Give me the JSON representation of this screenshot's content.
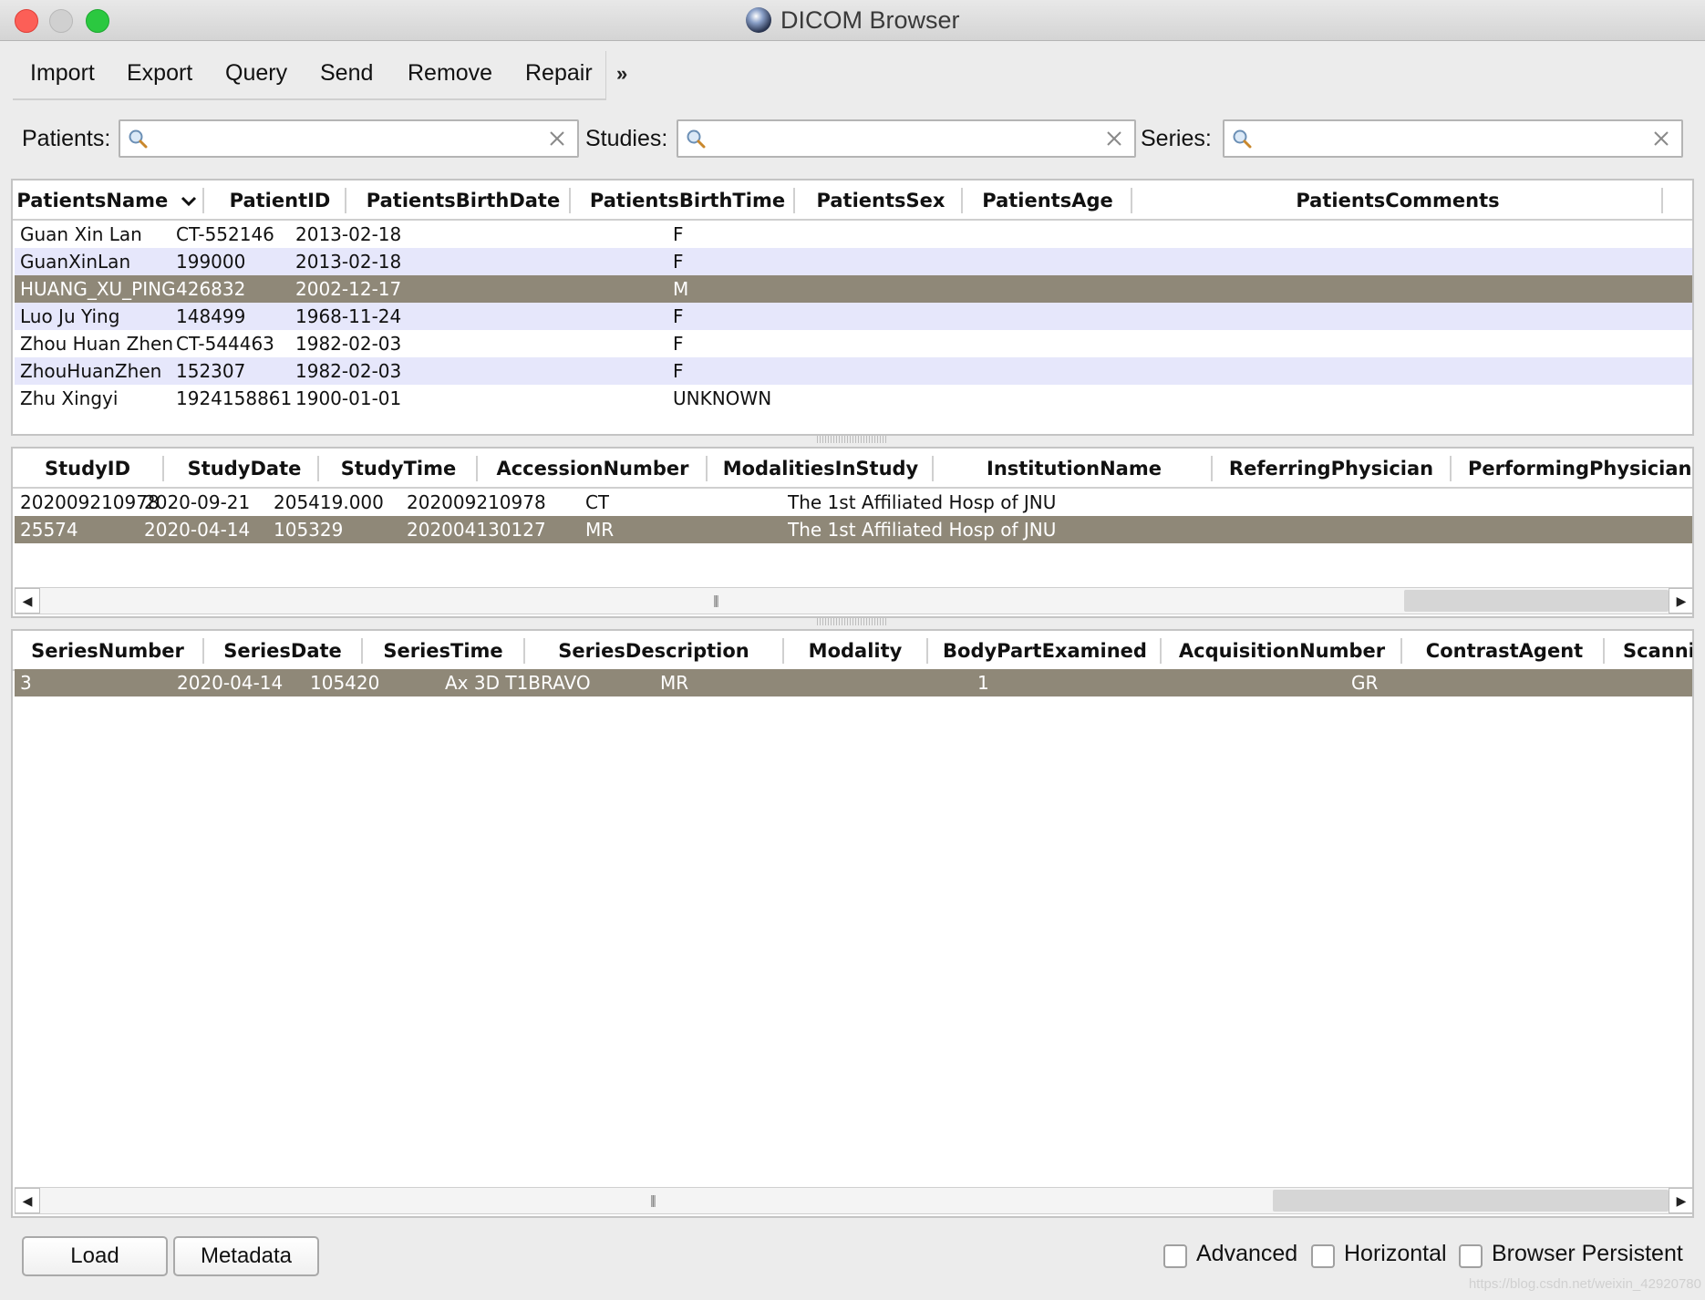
{
  "window": {
    "title": "DICOM Browser"
  },
  "toolbar": {
    "import": "Import",
    "export": "Export",
    "query": "Query",
    "send": "Send",
    "remove": "Remove",
    "repair": "Repair",
    "overflow": "»"
  },
  "filters": {
    "patients_label": "Patients:",
    "studies_label": "Studies:",
    "series_label": "Series:",
    "patients_value": "",
    "studies_value": "",
    "series_value": ""
  },
  "patients": {
    "columns": [
      "PatientsName",
      "PatientID",
      "PatientsBirthDate",
      "PatientsBirthTime",
      "PatientsSex",
      "PatientsAge",
      "PatientsComments"
    ],
    "sort_column": "PatientsName",
    "selected_row": 2,
    "rows": [
      [
        "Guan Xin Lan",
        "CT-552146",
        "2013-02-18",
        "",
        "F",
        "",
        ""
      ],
      [
        "GuanXinLan",
        "199000",
        "2013-02-18",
        "",
        "F",
        "",
        ""
      ],
      [
        "HUANG_XU_PING",
        "426832",
        "2002-12-17",
        "",
        "M",
        "",
        ""
      ],
      [
        "Luo Ju Ying",
        "148499",
        "1968-11-24",
        "",
        "F",
        "",
        ""
      ],
      [
        "Zhou Huan Zhen",
        "CT-544463",
        "1982-02-03",
        "",
        "F",
        "",
        ""
      ],
      [
        "ZhouHuanZhen",
        "152307",
        "1982-02-03",
        "",
        "F",
        "",
        ""
      ],
      [
        "Zhu Xingyi",
        "1924158861",
        "1900-01-01",
        "",
        "UNKNOWN",
        "",
        ""
      ]
    ]
  },
  "studies": {
    "columns": [
      "StudyID",
      "StudyDate",
      "StudyTime",
      "AccessionNumber",
      "ModalitiesInStudy",
      "InstitutionName",
      "ReferringPhysician",
      "PerformingPhysiciansN"
    ],
    "selected_row": 1,
    "rows": [
      [
        "202009210978",
        "2020-09-21",
        "205419.000",
        "202009210978",
        "CT",
        "The 1st  Affiliated Hosp of JNU",
        "",
        ""
      ],
      [
        "25574",
        "2020-04-14",
        "105329",
        "202004130127",
        "MR",
        "The 1st Affiliated Hosp of JNU",
        "",
        ""
      ]
    ]
  },
  "series": {
    "columns": [
      "SeriesNumber",
      "SeriesDate",
      "SeriesTime",
      "SeriesDescription",
      "Modality",
      "BodyPartExamined",
      "AcquisitionNumber",
      "ContrastAgent",
      "Scannin"
    ],
    "selected_row": 0,
    "rows": [
      [
        "3",
        "2020-04-14",
        "105420",
        "Ax 3D T1BRAVO",
        "MR",
        "",
        "1",
        "",
        "GR"
      ]
    ]
  },
  "bottom": {
    "load": "Load",
    "metadata": "Metadata",
    "advanced": "Advanced",
    "horizontal": "Horizontal",
    "browser_persistent": "Browser Persistent"
  },
  "watermark": "https://blog.csdn.net/weixin_42920780"
}
